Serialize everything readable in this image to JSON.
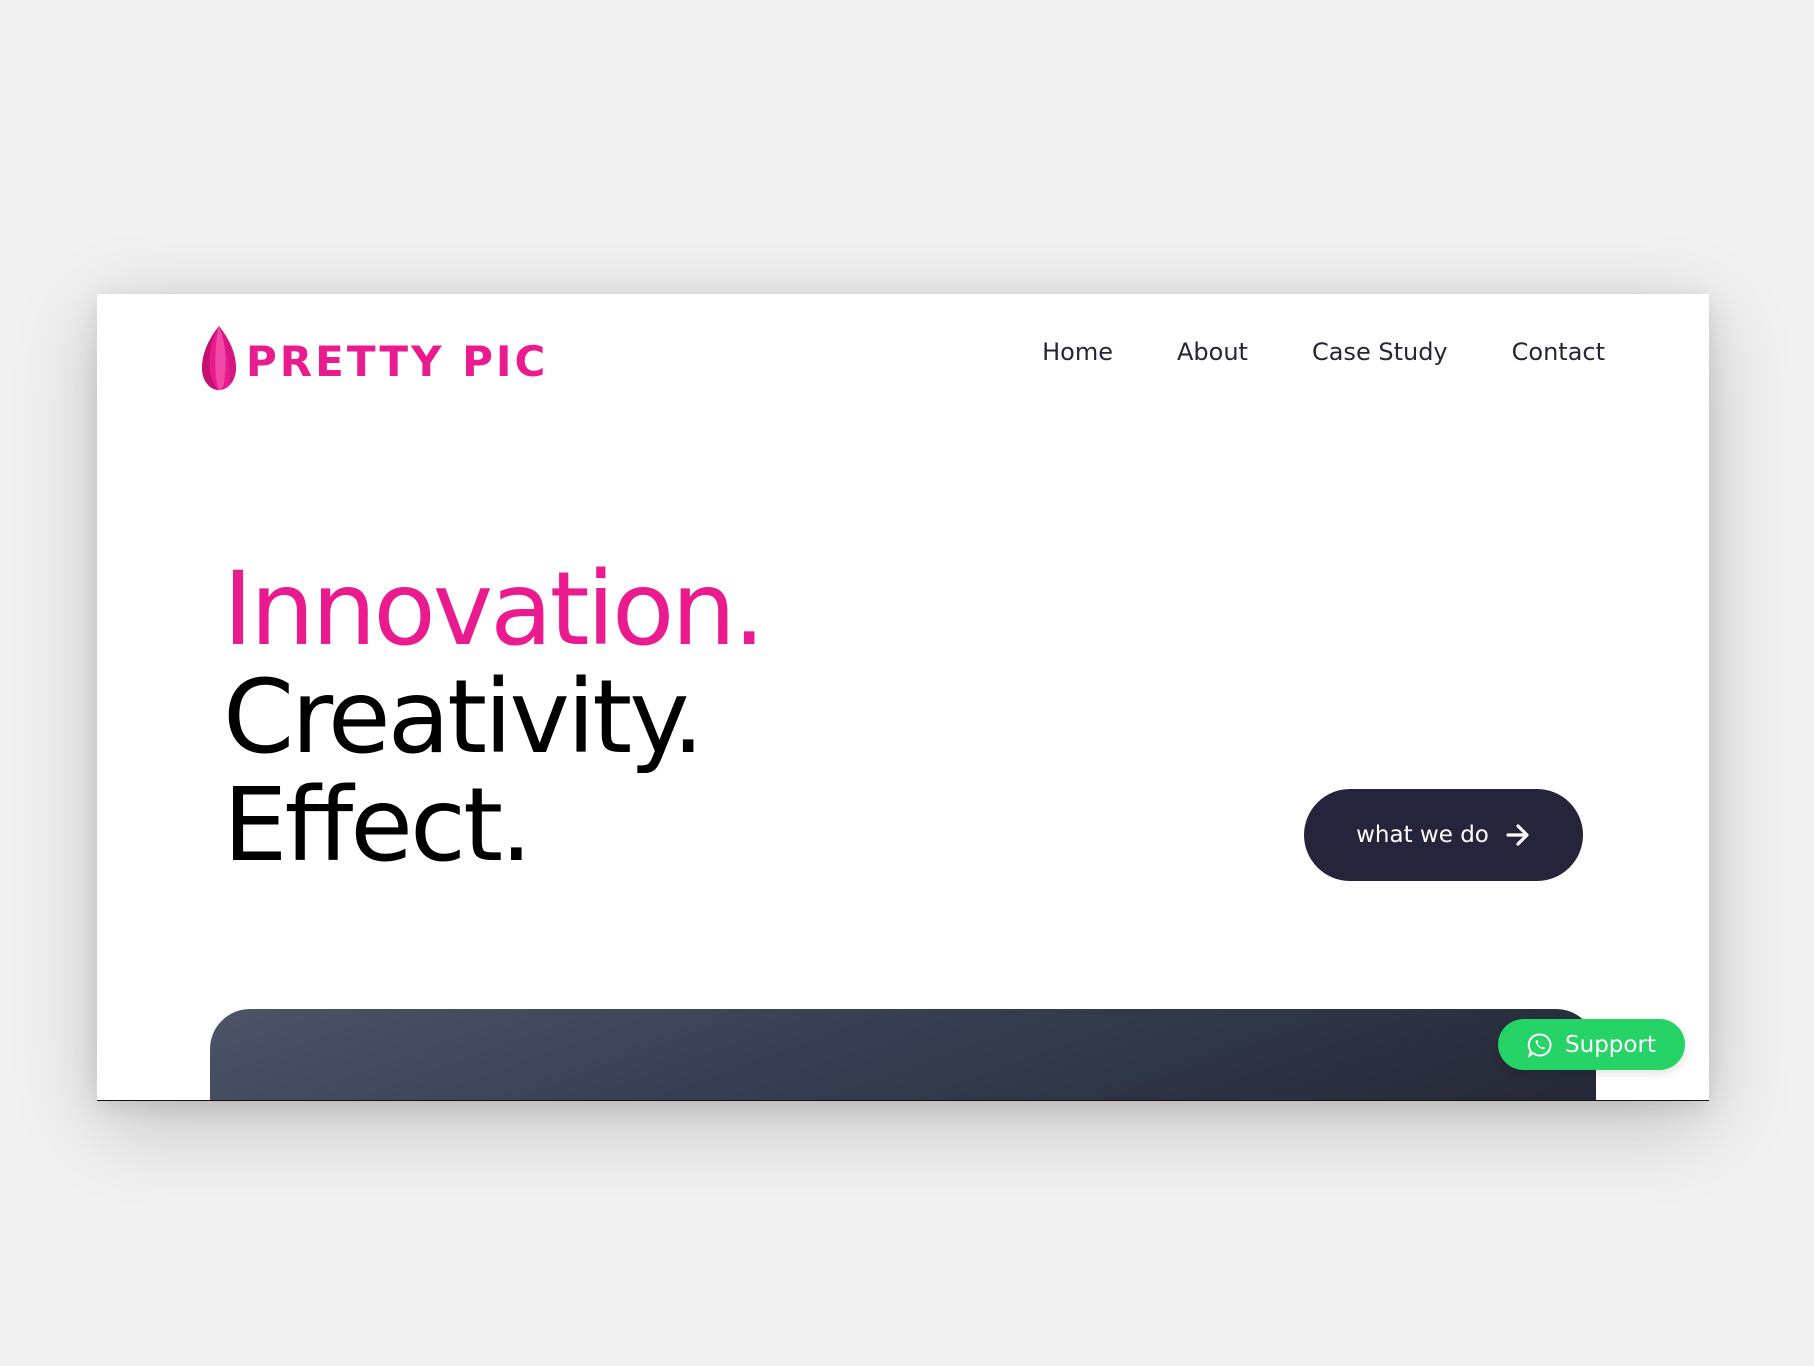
{
  "brand": {
    "name": "PRETTY PIC",
    "logo_icon": "pink-leaf-drop-logo",
    "accent_color": "#ea1a8f"
  },
  "nav": {
    "items": [
      {
        "label": "Home"
      },
      {
        "label": "About"
      },
      {
        "label": "Case Study"
      },
      {
        "label": "Contact"
      }
    ]
  },
  "hero": {
    "line1": "Innovation.",
    "line2": "Creativity.",
    "line3": "Effect."
  },
  "cta": {
    "label": "what we do",
    "icon": "arrow-right-icon",
    "background": "#25243a"
  },
  "support": {
    "label": "Support",
    "icon": "whatsapp-icon",
    "background": "#25d366"
  }
}
